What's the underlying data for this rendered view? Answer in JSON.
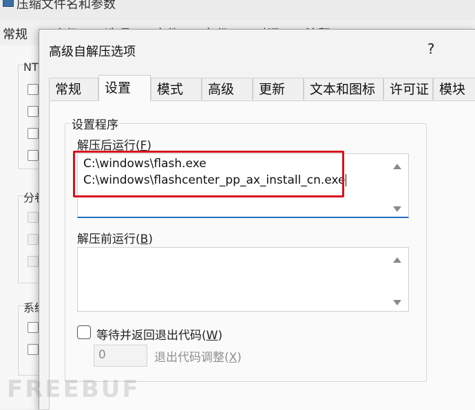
{
  "background_window": {
    "title": "压缩文件名和参数",
    "tabs": [
      "常规",
      "高级",
      "选项",
      "文件",
      "备份",
      "时间",
      "注释"
    ],
    "group_labels": [
      "NT",
      "分卷",
      "系统"
    ]
  },
  "dialog": {
    "title": "高级自解压选项",
    "help_label": "?",
    "tabs": [
      "常规",
      "设置",
      "模式",
      "高级",
      "更新",
      "文本和图标",
      "许可证",
      "模块"
    ],
    "active_tab": "设置"
  },
  "setup_group": {
    "legend": "设置程序",
    "run_after": {
      "label": "解压后运行(",
      "accel": "F",
      "label_end": ")",
      "lines": [
        "C:\\windows\\flash.exe",
        "C:\\windows\\flashcenter_pp_ax_install_cn.exe"
      ]
    },
    "run_before": {
      "label": "解压前运行(",
      "accel": "B",
      "label_end": ")",
      "lines": []
    },
    "wait_checkbox": {
      "label": "等待并返回退出代码(",
      "accel": "W",
      "label_end": ")",
      "checked": false
    },
    "exit_code": {
      "value": "0",
      "label": "退出代码调整(",
      "accel": "X",
      "label_end": ")"
    }
  },
  "colors": {
    "highlight": "#d8101f",
    "focus_underline": "#1f6fbf"
  },
  "watermark": "FREEBUF"
}
